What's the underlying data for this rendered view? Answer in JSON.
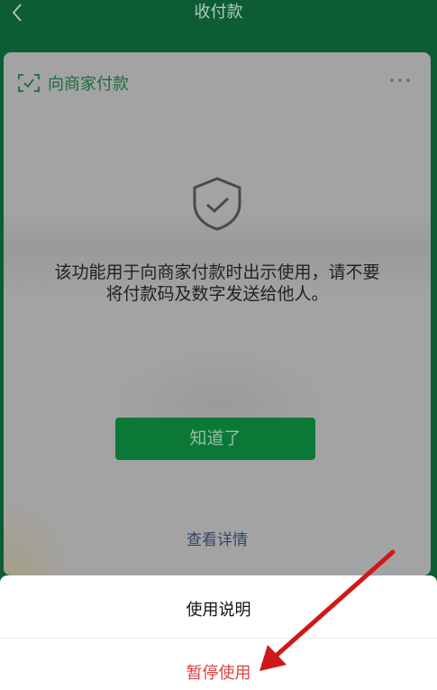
{
  "header": {
    "title": "收付款"
  },
  "card": {
    "title": "向商家付款",
    "notice_lines": [
      "该功能用于向商家付款时出示使用，请不要",
      "将付款码及数字发送给他人。"
    ],
    "ok_label": "知道了",
    "details_label": "查看详情"
  },
  "sheet": {
    "items": [
      {
        "label": "使用说明"
      },
      {
        "label": "暂停使用"
      }
    ]
  },
  "colors": {
    "header_bg": "#0c5d34",
    "accent_green": "#0c7838",
    "danger_red": "#e04040",
    "annotation_arrow": "#d01818"
  },
  "icons": [
    "back-icon",
    "scan-icon",
    "more-icon",
    "shield-check-icon",
    "annotation-arrow"
  ]
}
